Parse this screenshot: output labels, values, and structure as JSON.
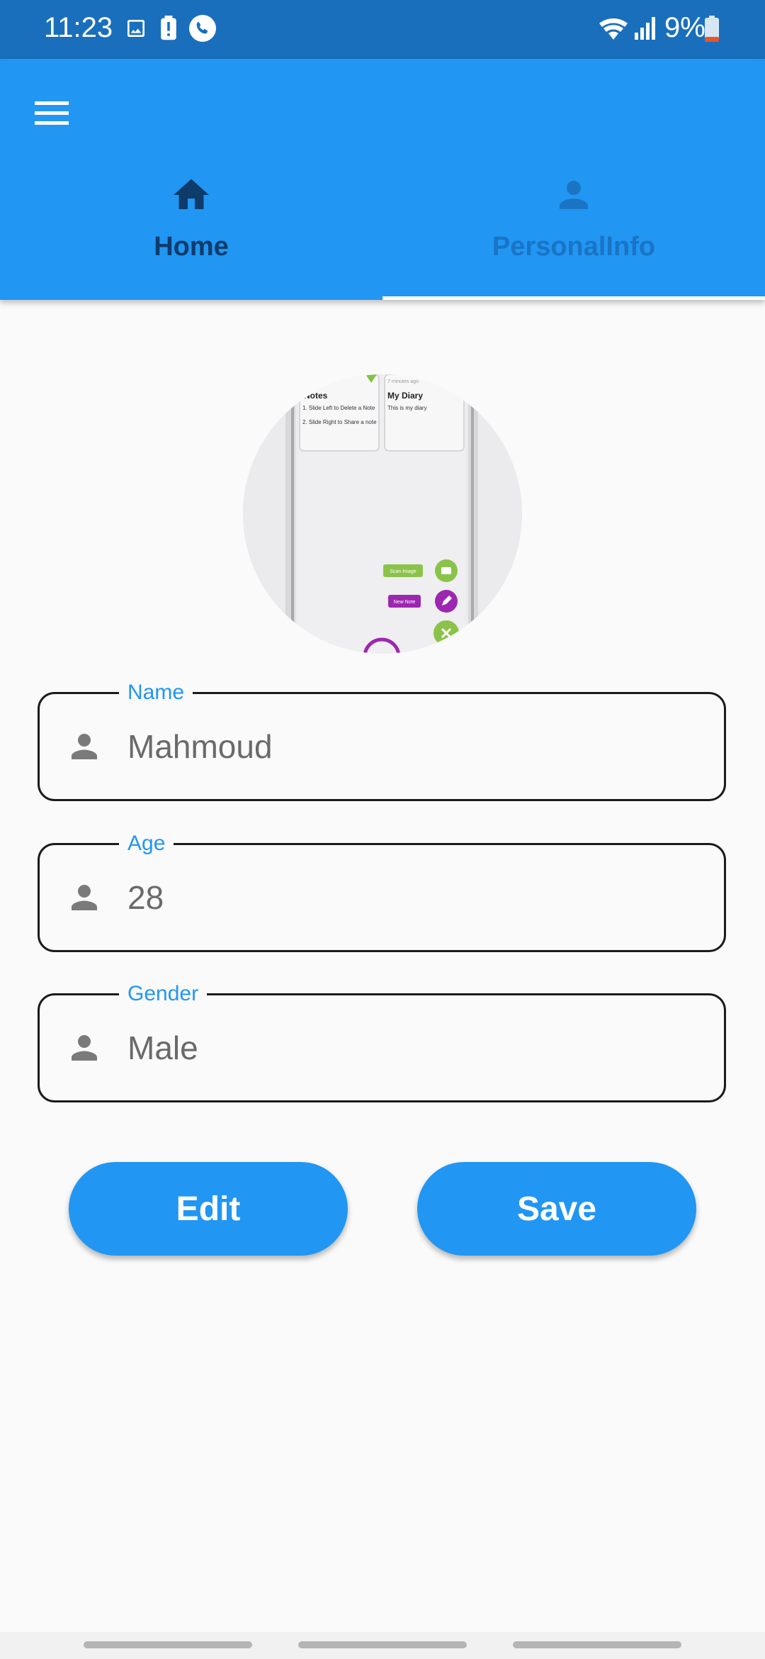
{
  "status_bar": {
    "time": "11:23",
    "battery": "9%",
    "icons": [
      "gallery-icon",
      "battery-alert-icon",
      "phone-call-icon",
      "wifi-icon",
      "signal-icon",
      "battery-icon"
    ]
  },
  "app_bar": {
    "menu_icon": "hamburger-menu-icon",
    "tabs": [
      {
        "label": "Home",
        "icon": "home-icon",
        "selected": false
      },
      {
        "label": "PersonalInfo",
        "icon": "person-icon",
        "selected": true
      }
    ]
  },
  "avatar": {
    "preview": {
      "card1_title": "Notes",
      "card1_lines": [
        "1. Slide Left to Delete a Note",
        "2. Slide Right to Share a note"
      ],
      "card2_meta": "7 minutes ago",
      "card2_title": "My Diary",
      "card2_text": "This is my diary",
      "fab1_label": "Scan Image",
      "fab2_label": "New Note"
    }
  },
  "form": {
    "name": {
      "label": "Name",
      "value": "Mahmoud",
      "icon": "person-icon"
    },
    "age": {
      "label": "Age",
      "value": "28",
      "icon": "person-icon"
    },
    "gender": {
      "label": "Gender",
      "value": "Male",
      "icon": "person-icon"
    }
  },
  "buttons": {
    "edit": "Edit",
    "save": "Save"
  },
  "colors": {
    "status_bar": "#1a6fbd",
    "primary": "#2196f3",
    "tab_selected_text": "#0d3c6b",
    "tab_unselected_text": "#1a74c4",
    "background": "#fafafa"
  }
}
